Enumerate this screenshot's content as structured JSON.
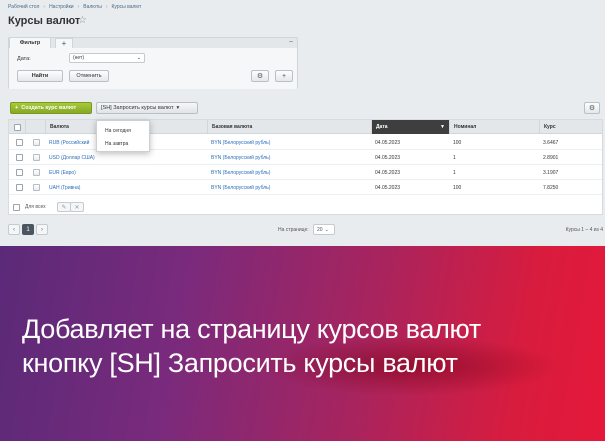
{
  "breadcrumb": [
    "Рабочий стол",
    "Настройки",
    "Валюты",
    "Курсы валют"
  ],
  "page_title": "Курсы валют",
  "filter": {
    "tab_label": "Фильтр",
    "add_tab": "+",
    "collapse": "–",
    "date_label": "Дата:",
    "date_value": "(нет)",
    "find_button": "Найти",
    "cancel_button": "Отменить"
  },
  "toolbar": {
    "add_button": "Создать курс валют",
    "request_button": "[SH] Запросить курсы валют"
  },
  "dropdown": [
    "На сегодня",
    "На завтра"
  ],
  "columns": [
    "Валюта",
    "Базовая валюта",
    "Дата",
    "Номинал",
    "Курс"
  ],
  "rows": [
    {
      "currency": "RUB (Российский",
      "base": "BYN (Белорусский рубль)",
      "date": "04.05.2023",
      "nominal": "100",
      "rate": "3.6467"
    },
    {
      "currency": "USD (Доллар США)",
      "base": "BYN (Белорусский рубль)",
      "date": "04.05.2023",
      "nominal": "1",
      "rate": "2.8901"
    },
    {
      "currency": "EUR (Евро)",
      "base": "BYN (Белорусский рубль)",
      "date": "04.05.2023",
      "nominal": "1",
      "rate": "3.1907"
    },
    {
      "currency": "UAH (Гривна)",
      "base": "BYN (Белорусский рубль)",
      "date": "04.05.2023",
      "nominal": "100",
      "rate": "7.8250"
    }
  ],
  "footer": {
    "for_all": "Для всех"
  },
  "pager": {
    "current_page": "1",
    "per_page_label": "На странице:",
    "per_page_value": "20",
    "total": "Курсы 1 – 4 из 4"
  },
  "banner": {
    "line1": "Добавляет на страницу курсов валют",
    "line2": "кнопку [SH] Запросить курсы валют"
  },
  "colors": {
    "accent_green": "#8fb22c",
    "link_blue": "#2a6ebb",
    "banner_start": "#5a2a78",
    "banner_end": "#e5183a"
  }
}
